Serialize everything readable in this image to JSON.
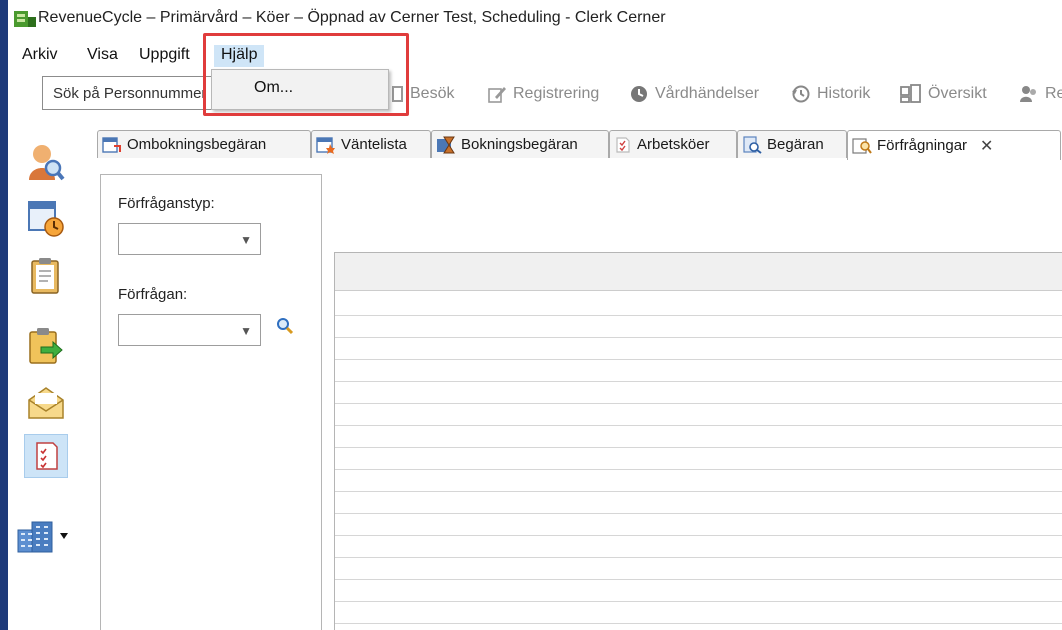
{
  "window": {
    "title": "RevenueCycle – Primärvård – Köer – Öppnad av Cerner Test, Scheduling - Clerk Cerner"
  },
  "menu": {
    "items": [
      "Arkiv",
      "Visa",
      "Uppgift",
      "Hjälp"
    ],
    "open_menu": "Hjälp",
    "dropdown_items": [
      "Om..."
    ]
  },
  "toolbar": {
    "search_value": "Sök på Personnummer",
    "buttons": [
      "Besök",
      "Registrering",
      "Vårdhändelser",
      "Historik",
      "Översikt",
      "Re"
    ]
  },
  "tabs": [
    {
      "label": "Ombokningsbegäran",
      "icon": "calendar-clock-icon"
    },
    {
      "label": "Väntelista",
      "icon": "calendar-star-icon"
    },
    {
      "label": "Bokningsbegäran",
      "icon": "hourglass-icon"
    },
    {
      "label": "Arbetsköer",
      "icon": "workqueue-icon"
    },
    {
      "label": "Begäran",
      "icon": "document-search-icon"
    },
    {
      "label": "Förfrågningar",
      "icon": "query-icon",
      "active": true
    }
  ],
  "left_panel": {
    "type_label": "Förfråganstyp:",
    "type_value": "",
    "query_label": "Förfrågan:",
    "query_value": ""
  },
  "colors": {
    "highlight": "#e03c3c",
    "menu_active": "#cfe5f7",
    "window_edge": "#1e3a7a"
  }
}
